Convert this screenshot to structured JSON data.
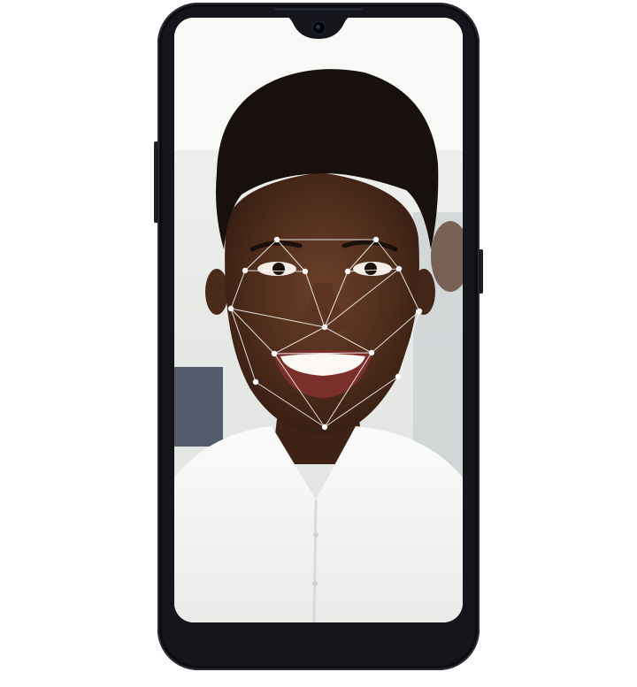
{
  "device": {
    "type": "smartphone",
    "frame_color": "#15161b"
  },
  "screen": {
    "content": "face-recognition",
    "overlay_color": "#ffffff",
    "icons": [
      "front-camera-icon",
      "face-scan-mesh-icon"
    ]
  }
}
